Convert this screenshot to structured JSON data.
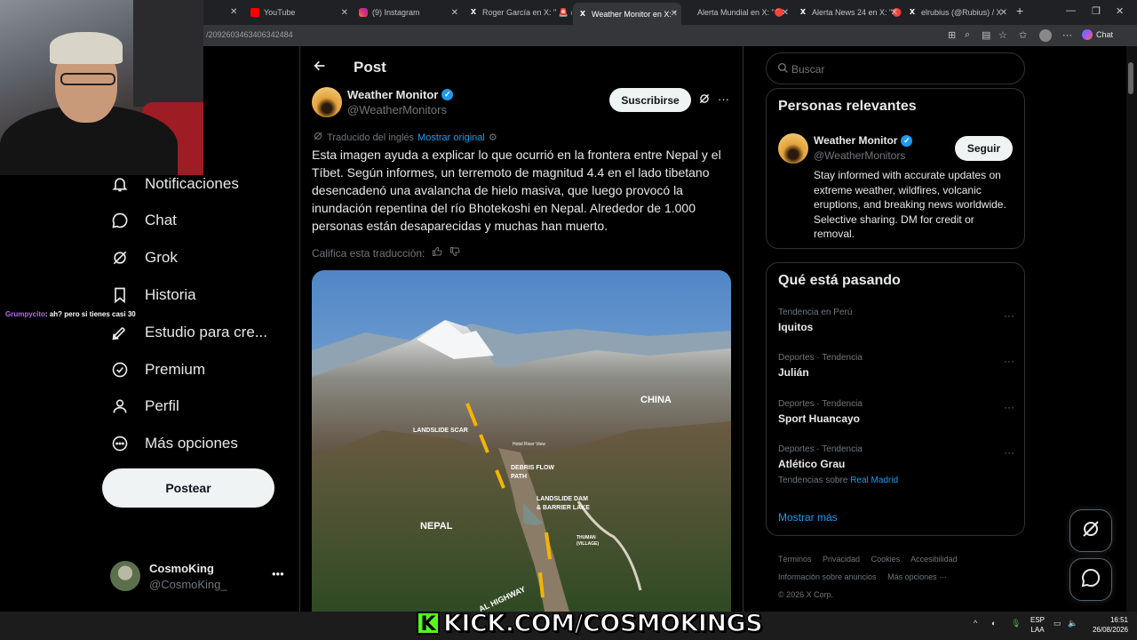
{
  "browser": {
    "tabs": [
      {
        "label": "YouTube",
        "icon": "youtube-icon"
      },
      {
        "label": "(9) Instagram",
        "icon": "instagram-icon"
      },
      {
        "label": "Roger García en X: \" 🚨 #",
        "icon": "x-icon"
      },
      {
        "label": "Weather Monitor en X: \"",
        "icon": "x-icon",
        "active": true
      },
      {
        "label": "Alerta Mundial en X: \"🔴",
        "icon": "x-icon"
      },
      {
        "label": "Alerta News 24 en X: \"🔴",
        "icon": "x-icon"
      },
      {
        "label": "elrubius (@Rubius) / X",
        "icon": "x-icon"
      }
    ],
    "url": "/2092603463406342484",
    "chat_label": "Chat"
  },
  "stream": {
    "chat_user": "Grumpycito",
    "chat_message": ": ah? pero si tienes casi 30",
    "kick_banner": "KICK.COM/COSMOKINGS",
    "kick_logo": "K"
  },
  "nav": {
    "items": [
      {
        "label": "Notificaciones",
        "icon": "bell-icon"
      },
      {
        "label": "Chat",
        "icon": "chat-bubble-icon"
      },
      {
        "label": "Grok",
        "icon": "grok-icon"
      },
      {
        "label": "Historia",
        "icon": "bookmark-icon"
      },
      {
        "label": "Estudio para cre...",
        "icon": "rocket-icon"
      },
      {
        "label": "Premium",
        "icon": "verified-badge-icon"
      },
      {
        "label": "Perfil",
        "icon": "person-icon"
      },
      {
        "label": "Más opciones",
        "icon": "more-circle-icon"
      }
    ],
    "post_button": "Postear",
    "account": {
      "name": "CosmoKing",
      "handle": "@CosmoKing_"
    }
  },
  "post": {
    "header": "Post",
    "author_name": "Weather Monitor",
    "author_handle": "@WeatherMonitors",
    "subscribe_label": "Suscribirse",
    "translated_from": "Traducido del inglés",
    "show_original": "Mostrar original",
    "text": "Esta imagen ayuda a explicar lo que ocurrió en la frontera entre Nepal y el Tíbet. Según informes, un terremoto de magnitud 4.4 en el lado tibetano desencadenó una avalancha de hielo masiva, que luego provocó la inundación repentina del río Bhotekoshi en Nepal. Alrededor de 1.000 personas están desaparecidas y muchas han muerto.",
    "rate_translation": "Califica esta traducción:",
    "image_labels": {
      "china": "CHINA",
      "nepal": "NEPAL",
      "landslide_scar": "LANDSLIDE SCAR",
      "hotel": "Hotel River View",
      "debris_flow": "DEBRIS FLOW\nPATH",
      "landslide_dam": "LANDSLIDE DAM\n& BARRIER LAKE",
      "thuman": "THUMAN\n(VILLAGE)",
      "highway": "AL HIGHWAY"
    }
  },
  "right": {
    "search_placeholder": "Buscar",
    "relevant_title": "Personas relevantes",
    "relevant": {
      "name": "Weather Monitor",
      "handle": "@WeatherMonitors",
      "follow_label": "Seguir",
      "bio": "Stay informed with accurate updates on extreme weather, wildfires, volcanic eruptions, and breaking news worldwide. Selective sharing. DM for credit or removal."
    },
    "trends_title": "Qué está pasando",
    "trends": [
      {
        "meta": "Tendencia en Perú",
        "name": "Iquitos"
      },
      {
        "meta": "Deportes · Tendencia",
        "name": "Julián"
      },
      {
        "meta": "Deportes · Tendencia",
        "name": "Sport Huancayo"
      },
      {
        "meta": "Deportes · Tendencia",
        "name": "Atlético Grau",
        "about_prefix": "Tendencias sobre",
        "about_link": "Real Madrid"
      }
    ],
    "show_more": "Mostrar más",
    "footer": [
      "Términos",
      "Privacidad",
      "Cookies",
      "Accesibilidad",
      "Información sobre anuncios",
      "Más opciones ···",
      "© 2026 X Corp."
    ]
  },
  "taskbar": {
    "lang_top": "ESP",
    "lang_bottom": "LAA",
    "time": "16:51",
    "date": "26/08/2026"
  },
  "colors": {
    "accent": "#1d9bf0",
    "background": "#000000",
    "border": "#2f3336",
    "kick_green": "#53fc18"
  }
}
